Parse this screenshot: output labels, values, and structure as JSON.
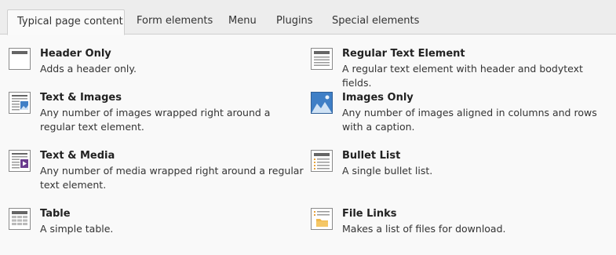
{
  "tabs": [
    {
      "label": "Typical page content",
      "active": true
    },
    {
      "label": "Form elements",
      "active": false
    },
    {
      "label": "Menu",
      "active": false
    },
    {
      "label": "Plugins",
      "active": false
    },
    {
      "label": "Special elements",
      "active": false
    }
  ],
  "items": [
    {
      "title": "Header Only",
      "description": "Adds a header only.",
      "icon": "header-only-icon"
    },
    {
      "title": "Regular Text Element",
      "description": "A regular text element with header and bodytext fields.",
      "icon": "text-element-icon"
    },
    {
      "title": "Text & Images",
      "description": "Any number of images wrapped right around a regular text element.",
      "icon": "text-images-icon"
    },
    {
      "title": "Images Only",
      "description": "Any number of images aligned in columns and rows with a caption.",
      "icon": "images-only-icon"
    },
    {
      "title": "Text & Media",
      "description": "Any number of media wrapped right around a regular text element.",
      "icon": "text-media-icon"
    },
    {
      "title": "Bullet List",
      "description": "A single bullet list.",
      "icon": "bullet-list-icon"
    },
    {
      "title": "Table",
      "description": "A simple table.",
      "icon": "table-icon"
    },
    {
      "title": "File Links",
      "description": "Makes a list of files for download.",
      "icon": "file-links-icon"
    }
  ],
  "colors": {
    "icon_border": "#8a8a8a",
    "image_blue": "#3f7fc6",
    "media_purple": "#6a3c8e",
    "bullet_orange": "#e8a33c",
    "folder_yellow": "#f0b84a"
  }
}
